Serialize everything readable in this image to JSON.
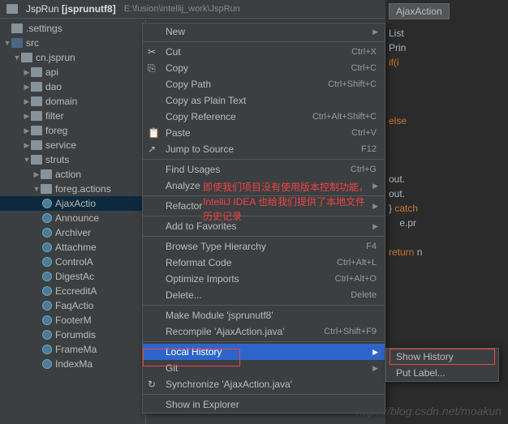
{
  "header": {
    "project_prefix": "JspRun",
    "project_name": "[jsprunutf8]",
    "path": "E:\\fusion\\intellij_work\\JspRun"
  },
  "tree": {
    "settings": ".settings",
    "src": "src",
    "pkg": "cn.jsprun",
    "folders": [
      "api",
      "dao",
      "domain",
      "filter",
      "foreg",
      "service",
      "struts"
    ],
    "action": "action",
    "foreg_actions": "foreg.actions",
    "classes": [
      "AjaxActio",
      "Announce",
      "Archiver",
      "Attachme",
      "ControlA",
      "DigestAc",
      "EccreditA",
      "FaqActio",
      "FooterM",
      "Forumdis",
      "FrameMa",
      "IndexMa"
    ]
  },
  "editor": {
    "tab": "AjaxAction",
    "lines": [
      "List",
      "Prin",
      "if(i",
      "",
      "",
      "",
      "else",
      "",
      "",
      "",
      "out.",
      "out.",
      "} catch",
      "    e.pr",
      "",
      "return n"
    ]
  },
  "menu": {
    "new": "New",
    "cut": "Cut",
    "copy": "Copy",
    "copy_path": "Copy Path",
    "copy_plain": "Copy as Plain Text",
    "copy_ref": "Copy Reference",
    "paste": "Paste",
    "jump": "Jump to Source",
    "find_usages": "Find Usages",
    "analyze": "Analyze",
    "refactor": "Refactor",
    "add_fav": "Add to Favorites",
    "browse_type": "Browse Type Hierarchy",
    "reformat": "Reformat Code",
    "optimize": "Optimize Imports",
    "delete": "Delete...",
    "make_module": "Make Module 'jsprunutf8'",
    "recompile": "Recompile 'AjaxAction.java'",
    "local_history": "Local History",
    "git": "Git",
    "synchronize": "Synchronize 'AjaxAction.java'",
    "show_explorer": "Show in Explorer"
  },
  "shortcuts": {
    "cut": "Ctrl+X",
    "copy": "Ctrl+C",
    "copy_path": "Ctrl+Shift+C",
    "copy_ref": "Ctrl+Alt+Shift+C",
    "paste": "Ctrl+V",
    "jump": "F12",
    "find_usages": "Ctrl+G",
    "browse_type": "F4",
    "reformat": "Ctrl+Alt+L",
    "optimize": "Ctrl+Alt+O",
    "delete": "Delete",
    "recompile": "Ctrl+Shift+F9"
  },
  "submenu": {
    "show_history": "Show History",
    "put_label": "Put Label..."
  },
  "annotations": {
    "line1": "即使我们项目没有使用版本控制功能，",
    "line2": "IntelliJ IDEA 也给我们提供了本地文件",
    "line3": "历史记录"
  },
  "watermark": "https://blog.csdn.net/moakun"
}
